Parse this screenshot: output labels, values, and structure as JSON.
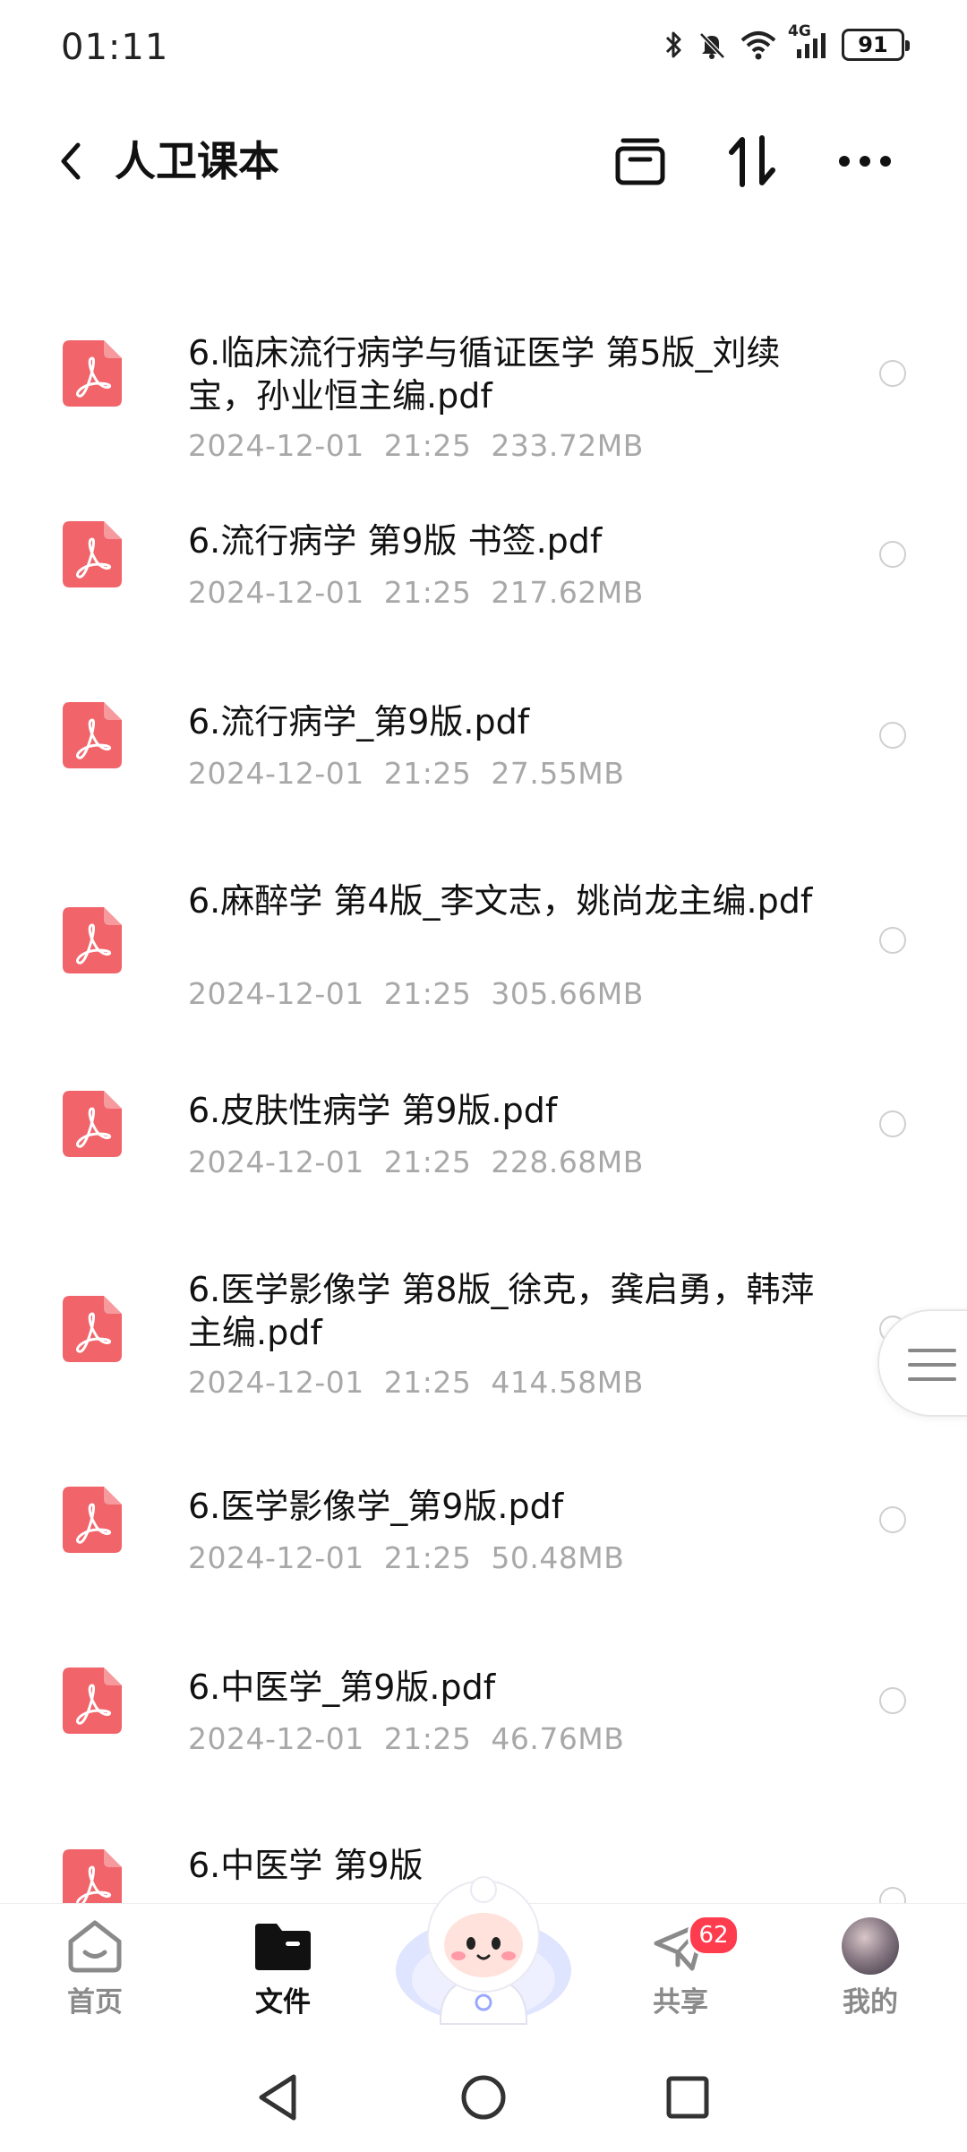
{
  "status_bar": {
    "time": "01:11",
    "network": "4G",
    "battery": "91",
    "icons": [
      "bluetooth-icon",
      "mute-bell-icon",
      "wifi-icon",
      "signal-icon",
      "battery-icon"
    ]
  },
  "header": {
    "title": "人卫课本",
    "icons": [
      "back-icon",
      "multi-select-icon",
      "sort-icon",
      "more-icon"
    ]
  },
  "files": [
    {
      "name": "6.临床流行病学与循证医学 第5版_刘续宝，孙业恒主编.pdf",
      "meta": "2024-12-01  21:25  233.72MB"
    },
    {
      "name": "6.流行病学 第9版 书签.pdf",
      "meta": "2024-12-01  21:25  217.62MB"
    },
    {
      "name": "6.流行病学_第9版.pdf",
      "meta": "2024-12-01  21:25  27.55MB"
    },
    {
      "name": "6.麻醉学 第4版_李文志，姚尚龙主编.pdf",
      "meta": "2024-12-01  21:25  305.66MB"
    },
    {
      "name": "6.皮肤性病学 第9版.pdf",
      "meta": "2024-12-01  21:25  228.68MB"
    },
    {
      "name": "6.医学影像学 第8版_徐克，龚启勇，韩萍主编.pdf",
      "meta": "2024-12-01  21:25  414.58MB"
    },
    {
      "name": "6.医学影像学_第9版.pdf",
      "meta": "2024-12-01  21:25  50.48MB"
    },
    {
      "name": "6.中医学_第9版.pdf",
      "meta": "2024-12-01  21:25  46.76MB"
    },
    {
      "name": "6.中医学 第9版",
      "meta": ""
    }
  ],
  "bottom_nav": {
    "items": [
      {
        "label": "首页",
        "icon": "home-icon"
      },
      {
        "label": "文件",
        "icon": "folder-icon",
        "active": true
      },
      {
        "label": "",
        "icon": "mascot-icon"
      },
      {
        "label": "共享",
        "icon": "share-icon",
        "badge": "62"
      },
      {
        "label": "我的",
        "icon": "avatar"
      }
    ]
  },
  "system_nav": [
    "back-triangle-icon",
    "home-circle-icon",
    "recents-square-icon"
  ],
  "colors": {
    "pdf_icon": "#f0646a",
    "meta_text": "#a8a8a8",
    "badge": "#ff3b4e"
  }
}
